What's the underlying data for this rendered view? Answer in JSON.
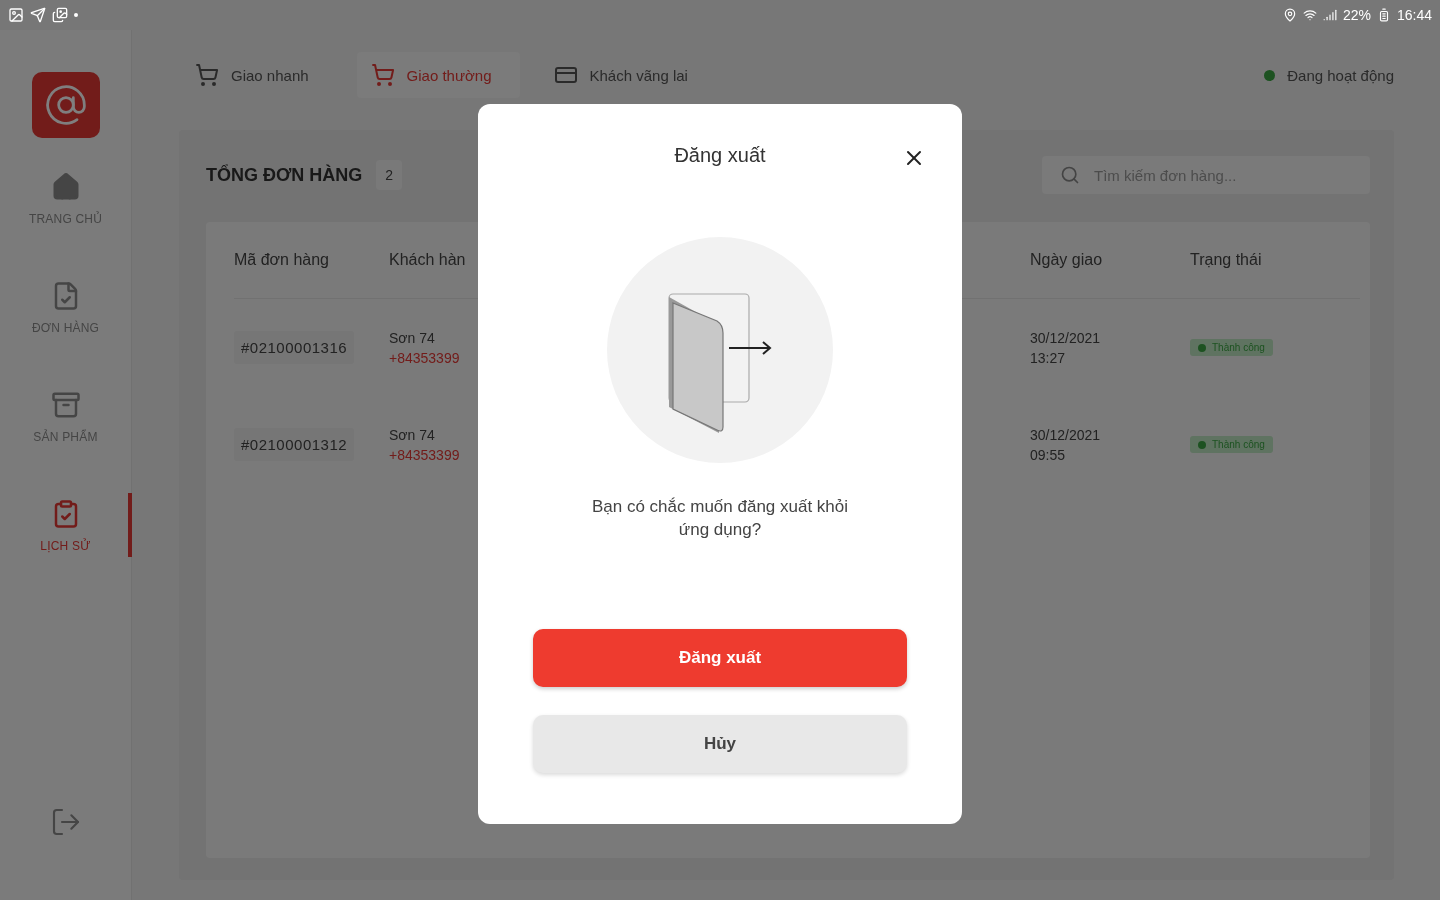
{
  "status_bar": {
    "battery": "22%",
    "time": "16:44"
  },
  "sidebar": {
    "items": [
      {
        "label": "TRANG CHỦ",
        "kind": "home",
        "selected": false
      },
      {
        "label": "ĐƠN HÀNG",
        "kind": "order",
        "selected": false
      },
      {
        "label": "SẢN PHẨM",
        "kind": "product",
        "selected": false
      },
      {
        "label": "LỊCH SỬ",
        "kind": "history",
        "selected": true
      }
    ]
  },
  "tabs": [
    {
      "label": "Giao nhanh",
      "kind": "cart",
      "selected": false
    },
    {
      "label": "Giao thường",
      "kind": "cart",
      "selected": true
    },
    {
      "label": "Khách vãng lai",
      "kind": "card",
      "selected": false
    }
  ],
  "connection": {
    "label": "Đang hoạt động",
    "online": true
  },
  "orders": {
    "title": "TỔNG ĐƠN HÀNG",
    "count": "2",
    "search": {
      "placeholder": "Tìm kiếm đơn hàng..."
    },
    "columns": [
      "Mã đơn hàng",
      "Khách hàn",
      "Ngày giao",
      "Trạng thái"
    ],
    "rows": [
      {
        "code": "#02100001316",
        "customer": "Sơn 74",
        "phone": "+84353399",
        "date": "30/12/2021",
        "time": "13:27",
        "status": "Thành công"
      },
      {
        "code": "#02100001312",
        "customer": "Sơn 74",
        "phone": "+84353399",
        "date": "30/12/2021",
        "time": "09:55",
        "status": "Thành công"
      }
    ]
  },
  "dialog": {
    "title": "Đăng xuất",
    "message": "Bạn có chắc muốn đăng xuất khỏi ứng dụng?",
    "confirm": "Đăng xuất",
    "cancel": "Hủy"
  }
}
